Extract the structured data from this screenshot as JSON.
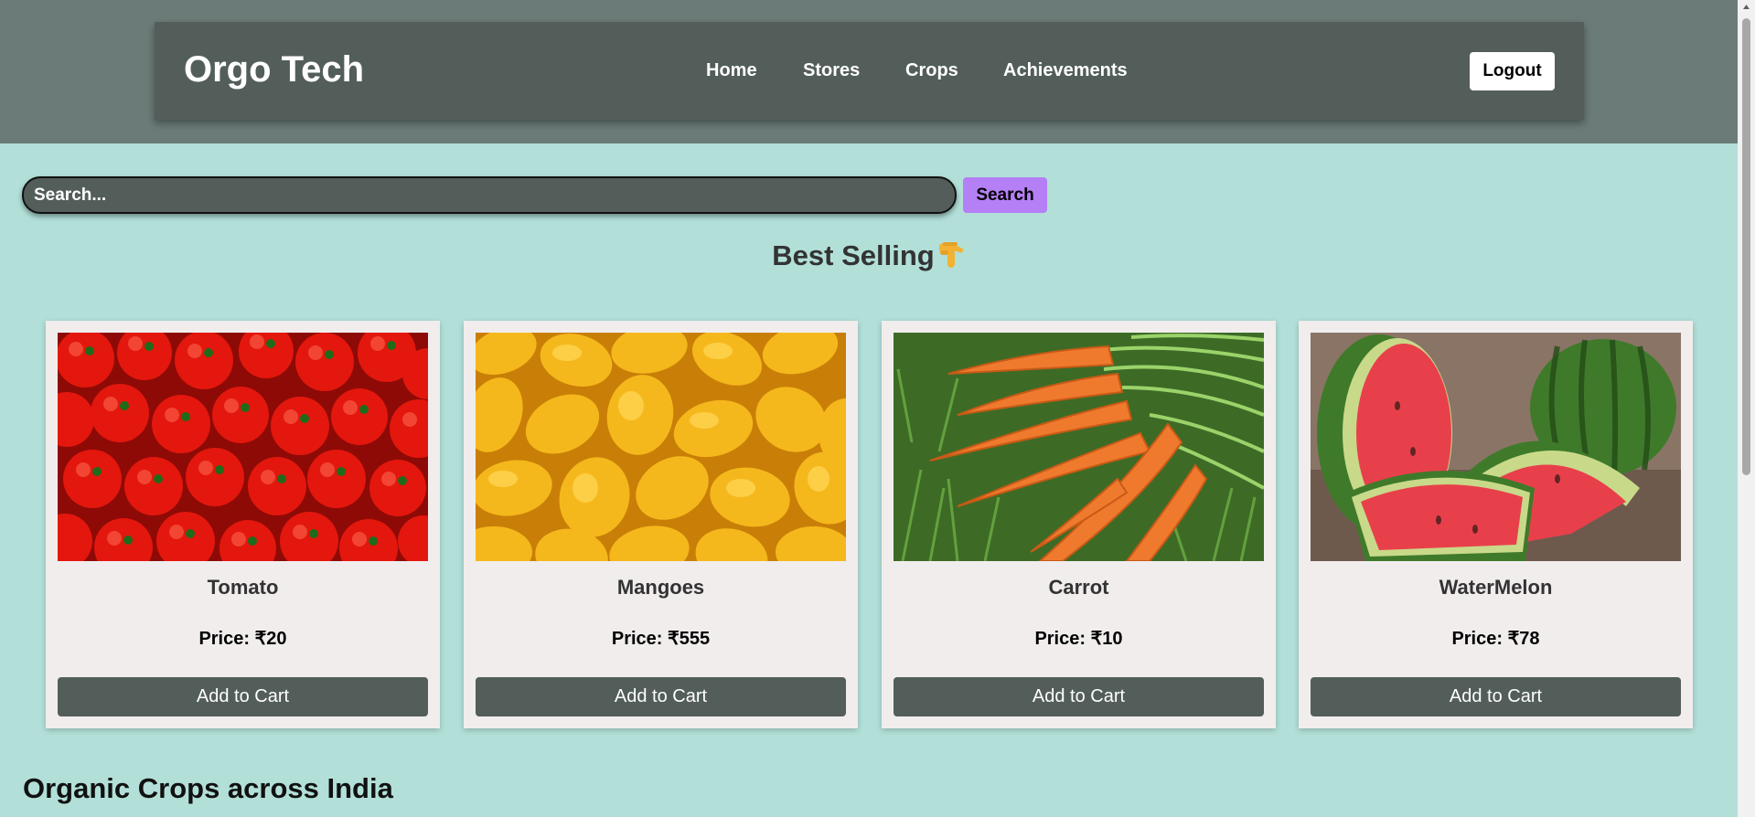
{
  "header": {
    "brand": "Orgo Tech",
    "nav": [
      "Home",
      "Stores",
      "Crops",
      "Achievements"
    ],
    "logout_label": "Logout"
  },
  "search": {
    "placeholder": "Search...",
    "button_label": "Search"
  },
  "best_selling": {
    "title": "Best Selling",
    "products": [
      {
        "name": "Tomato",
        "price": "Price: ₹20",
        "button": "Add to Cart"
      },
      {
        "name": "Mangoes",
        "price": "Price: ₹555",
        "button": "Add to Cart"
      },
      {
        "name": "Carrot",
        "price": "Price: ₹10",
        "button": "Add to Cart"
      },
      {
        "name": "WaterMelon",
        "price": "Price: ₹78",
        "button": "Add to Cart"
      }
    ]
  },
  "section2": {
    "title": "Organic Crops across India"
  },
  "colors": {
    "page_bg": "#b2e0d9",
    "header_band": "#6b7b77",
    "navbar": "#535e5a",
    "search_button": "#b57ff6",
    "card_bg": "#f1eded",
    "cart_button": "#535e5a"
  },
  "icons": {
    "title_icon": "pointing-down-hand-icon"
  }
}
